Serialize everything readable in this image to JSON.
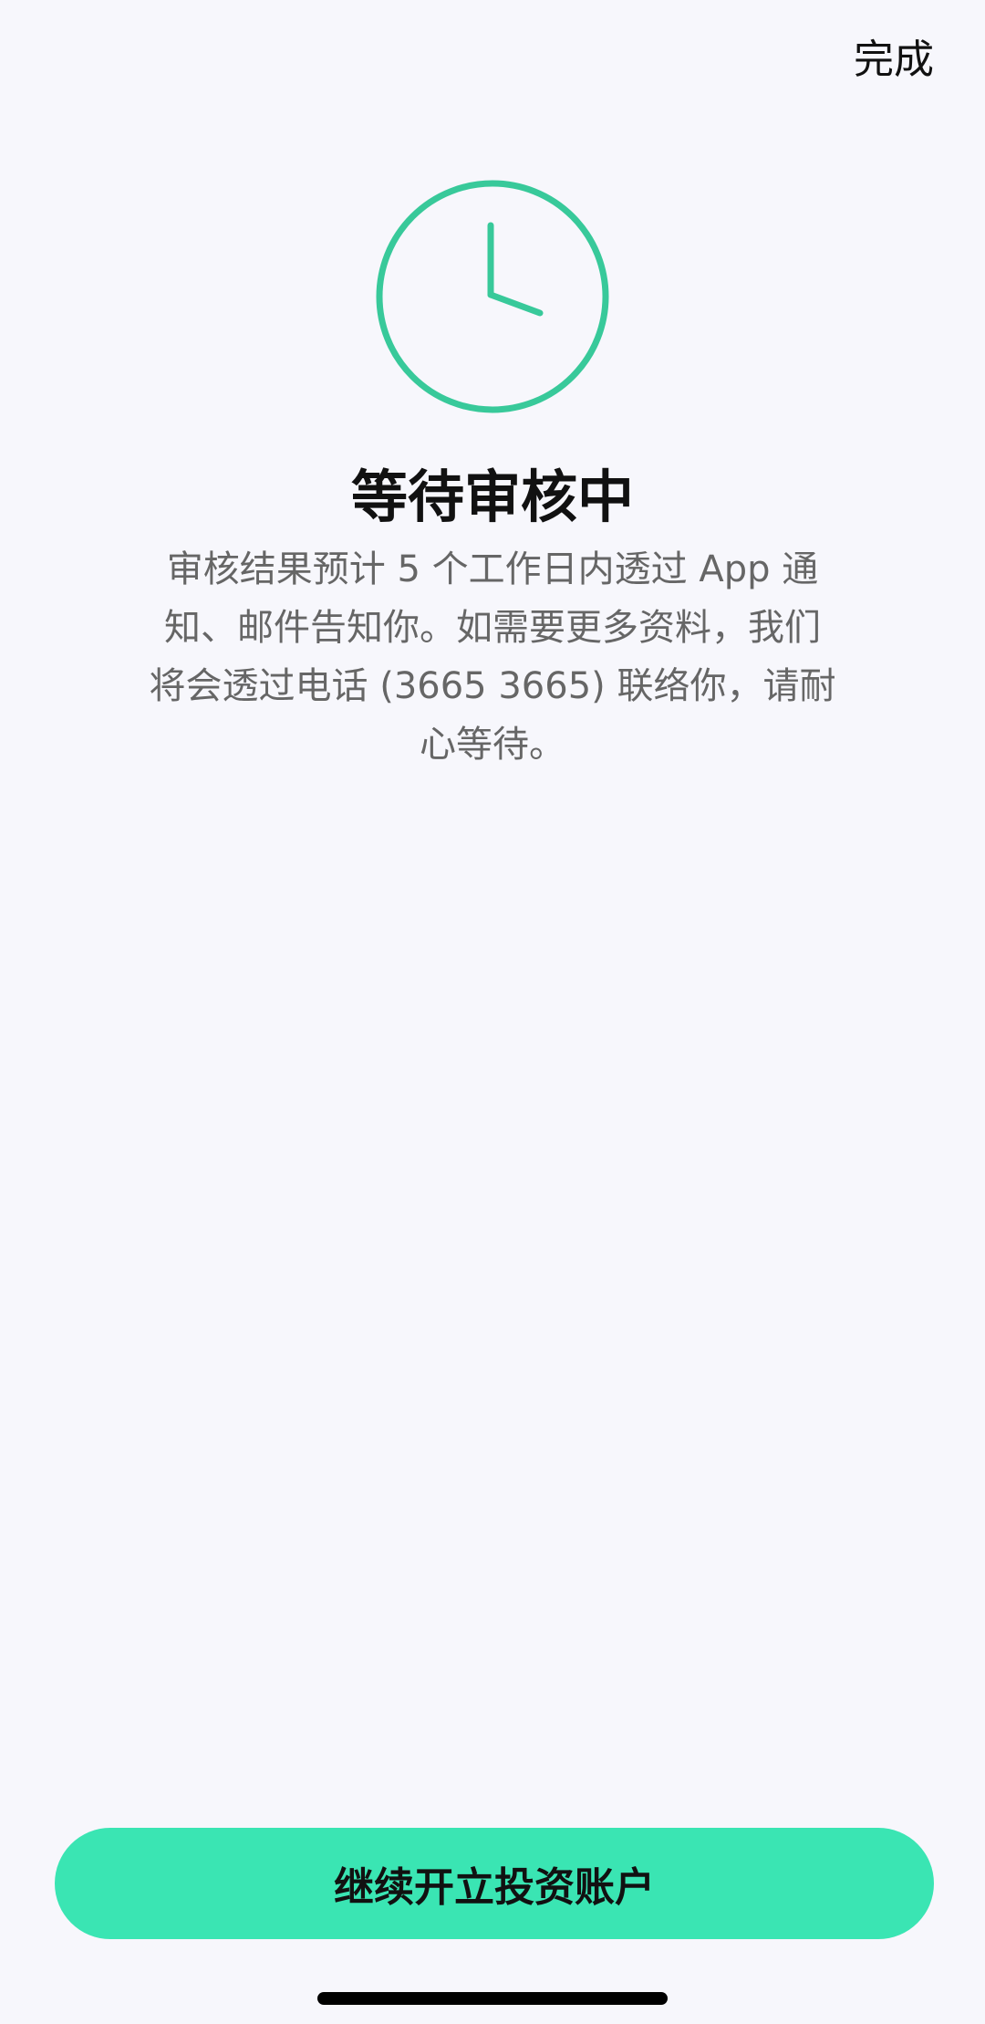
{
  "header": {
    "done_label": "完成"
  },
  "status": {
    "icon": "clock-icon",
    "accent_color": "#38C99A",
    "title": "等待审核中",
    "description": "审核结果预计 5 个工作日内透过 App 通\n知、邮件告知你。如需要更多资料，我们\n将会透过电话 (3665 3665) 联络你，请耐\n心等待。"
  },
  "footer": {
    "continue_label": "继续开立投资账户",
    "button_color": "#3AE5B3"
  }
}
